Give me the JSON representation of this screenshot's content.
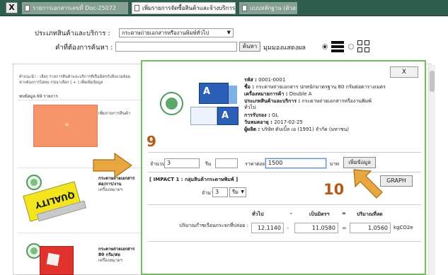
{
  "tabs": {
    "close": "X",
    "items": [
      {
        "label": "รายการเอกสารเลขที่ Doc-25072",
        "active": false
      },
      {
        "label": "เพิ่มรายการจัดซื้อสินค้าและจ้างบริการ",
        "active": true
      },
      {
        "label": "แบบหลักฐาน (ตัวอย่าง)",
        "active": false
      }
    ]
  },
  "search": {
    "category_label": "ประเภทสินค้าและบริการ :",
    "category_value": "กระดาษถ่ายเอกสารหรืองานพิมพ์ทั่วไป",
    "keyword_label": "คำที่ต้องการค้นหา :",
    "keyword_value": "",
    "search_button": "ค้นหา",
    "view_label": "มุมมองแสดงผล",
    "view_mode": "list"
  },
  "background": {
    "note_line1": "คำแนะนำ : เลือก รายการสินค้าและบริการที่เป็นมิตรกับสิ่งแวดล้อม",
    "note_line2": "หากต้องการไม่พบ กรุณาเลือก [ + ] เพื่อเพิ่มข้อมูล",
    "result_count": "พบข้อมูล 69 รายการ",
    "rows": [
      {
        "title": "เพิ่มรายการสินค้า",
        "subtitle": ""
      },
      {
        "title": "กระดาษถ่ายเอกสาร",
        "subtitle": "ต่อ/การ/งาน",
        "extra": "เครื่องหมายฯ"
      },
      {
        "title": "กระดาษถ่ายเอกสาร",
        "subtitle": "80 กรัม/ต่อ",
        "extra": "เครื่องหมายฯ"
      }
    ],
    "brand_text": "QUALITY"
  },
  "modal": {
    "close_button": "X",
    "product": {
      "id_label": "รหัส :",
      "id_value": "0001-0001",
      "name_label": "ชื่อ :",
      "name_value": "กระดาษถ่ายเอกสาร ปกหนักมาตรฐาน 80 กรัมต่อตารางเมตร",
      "brand_label": "เครื่องหมายการค้า :",
      "brand_value": "Double A",
      "category_label": "ประเภทสินค้าและบริการ :",
      "category_value": "กระดาษถ่ายเอกสารหรืองานพิมพ์",
      "category_value2": "ทั่วไป",
      "cert_label": "การรับรอง :",
      "cert_value": "GL",
      "expire_label": "วันหมดอายุ :",
      "expire_value": "2017-02-25",
      "maker_label": "ผู้ผลิต :",
      "maker_value": "บริษัท ดับเบิ้ล เอ (1991) จำกัด (มหาชน)",
      "box_letter": "A"
    },
    "order": {
      "qty_label": "จำนวน",
      "qty_value": "3",
      "qty_unit": "รีม",
      "price_label": "ราคาต่อหน่วย",
      "price_value": "1500",
      "currency": "บาท",
      "add_button": "เพิ่มข้อมูล"
    },
    "impact": {
      "title": "[ IMPACT 1 : กลุ่มสินค้ากระดาษพิมพ์ ]",
      "graph_button": "GRAPH",
      "qty_label": "จำนวน :",
      "qty_value": "3",
      "unit_value": "รีม",
      "col_general": "ทั่วไป",
      "col_minus": "-",
      "col_green": "เป็นมิตรฯ",
      "col_equals": "=",
      "col_reduce": "ปริมาณที่ลด",
      "row_label": "ปริมาณก๊าซเรือนกระจกที่ปล่อย :",
      "general_value": "12.1140",
      "green_value": "11.0580",
      "reduce_value": "1.0560",
      "unit": "kgCO2e"
    }
  },
  "annotations": {
    "step9": "9",
    "step10": "10",
    "color": "#b45a14",
    "arrow_color": "#e7a640"
  }
}
